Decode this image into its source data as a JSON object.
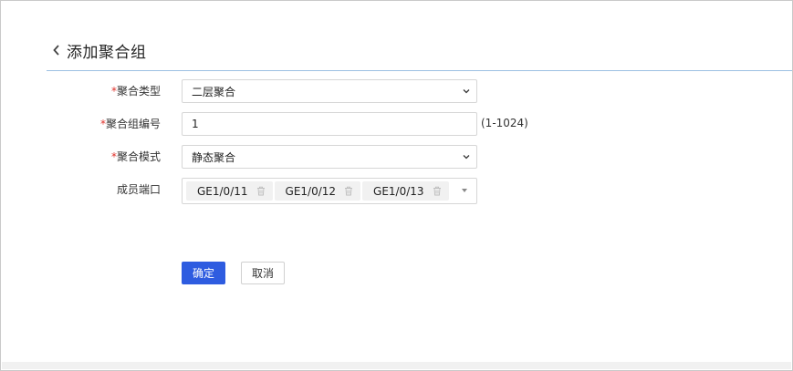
{
  "page": {
    "title": "添加聚合组"
  },
  "form": {
    "aggregation_type": {
      "label": "聚合类型",
      "required_mark": "*",
      "value": "二层聚合"
    },
    "group_number": {
      "label": "聚合组编号",
      "required_mark": "*",
      "value": "1",
      "range_hint": "(1-1024)"
    },
    "aggregation_mode": {
      "label": "聚合模式",
      "required_mark": "*",
      "value": "静态聚合"
    },
    "member_ports": {
      "label": "成员端口",
      "ports": [
        "GE1/0/11",
        "GE1/0/12",
        "GE1/0/13"
      ]
    }
  },
  "actions": {
    "confirm_label": "确定",
    "cancel_label": "取消"
  },
  "colors": {
    "primary": "#2e5ce0",
    "required": "#e0322b",
    "divider": "#9cc0e2"
  },
  "icons": {
    "back": "chevron-left-icon",
    "remove": "trash-icon",
    "dropdown": "chevron-down-icon"
  }
}
